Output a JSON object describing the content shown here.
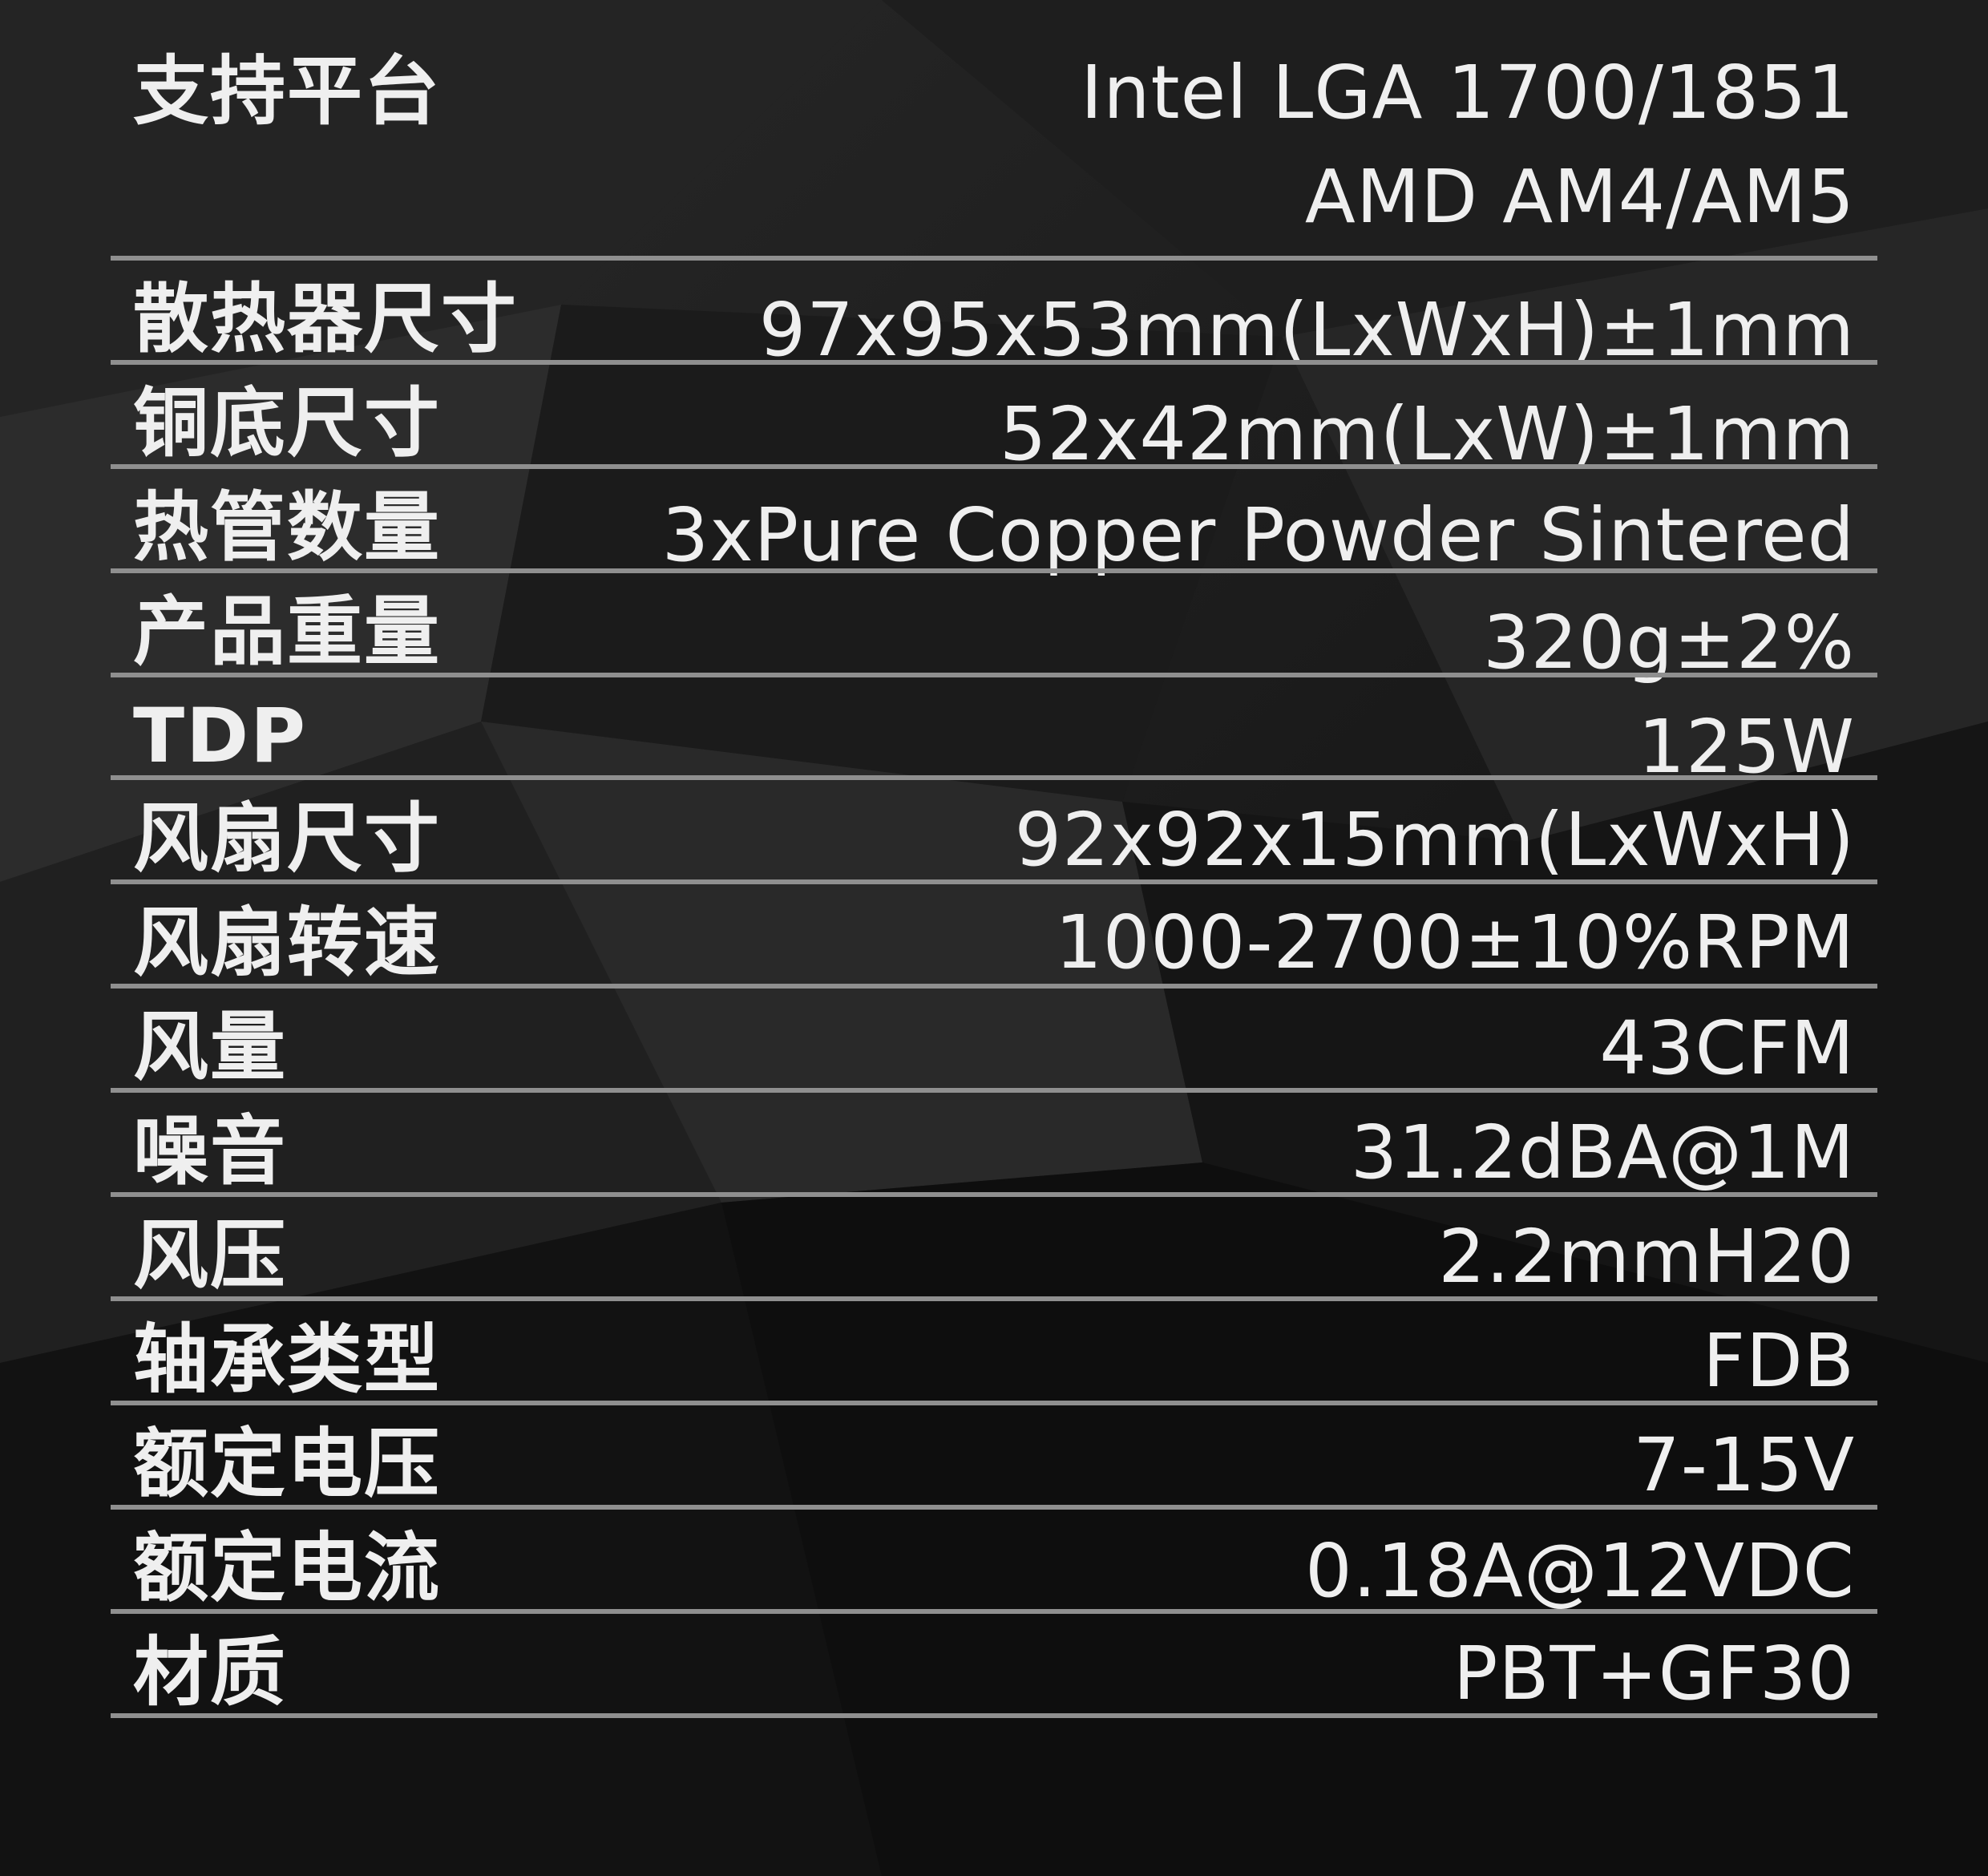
{
  "specs": [
    {
      "label": "支持平台",
      "values": [
        "Intel LGA 1700/1851",
        "AMD AM4/AM5"
      ]
    },
    {
      "label": "散热器尺寸",
      "values": [
        "97x95x53mm(LxWxH)±1mm"
      ]
    },
    {
      "label": "铜底尺寸",
      "values": [
        "52x42mm(LxW)±1mm"
      ]
    },
    {
      "label": "热管数量",
      "values": [
        "3xPure Copper Powder Sintered"
      ]
    },
    {
      "label": "产品重量",
      "values": [
        "320g±2%"
      ]
    },
    {
      "label": "TDP",
      "values": [
        "125W"
      ]
    },
    {
      "label": "风扇尺寸",
      "values": [
        "92x92x15mm(LxWxH)"
      ]
    },
    {
      "label": "风扇转速",
      "values": [
        "1000-2700±10%RPM"
      ]
    },
    {
      "label": "风量",
      "values": [
        "43CFM"
      ]
    },
    {
      "label": "噪音",
      "values": [
        "31.2dBA@1M"
      ]
    },
    {
      "label": "风压",
      "values": [
        "2.2mmH20"
      ]
    },
    {
      "label": "轴承类型",
      "values": [
        "FDB"
      ]
    },
    {
      "label": "额定电压",
      "values": [
        "7-15V"
      ]
    },
    {
      "label": "额定电流",
      "values": [
        "0.18A@12VDC"
      ]
    },
    {
      "label": "材质",
      "values": [
        "PBT+GF30"
      ]
    }
  ]
}
